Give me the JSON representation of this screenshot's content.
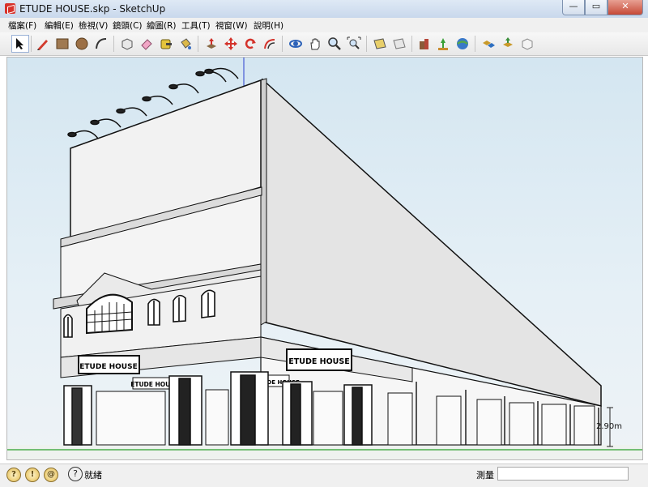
{
  "window": {
    "title": "ETUDE HOUSE.skp - SketchUp",
    "buttons": {
      "minimize": "—",
      "maximize": "▭",
      "close": "✕"
    }
  },
  "menu": [
    "檔案(F)",
    "編輯(E)",
    "檢視(V)",
    "鏡頭(C)",
    "繪圖(R)",
    "工具(T)",
    "視窗(W)",
    "說明(H)"
  ],
  "toolbar": {
    "tools": [
      "select-icon",
      "pencil-icon",
      "rectangle-icon",
      "circle-icon",
      "arc-icon",
      "make-component-icon",
      "eraser-icon",
      "tape-measure-icon",
      "paint-bucket-icon",
      "push-pull-icon",
      "move-icon",
      "rotate-icon",
      "offset-icon",
      "orbit-icon",
      "pan-icon",
      "zoom-icon",
      "zoom-extents-icon",
      "add-location-icon",
      "toggle-terrain-icon",
      "photo-textures-icon",
      "preview-in-google-earth-icon",
      "get-models-icon",
      "share-model-icon",
      "share-component-icon",
      "components-icon"
    ],
    "active_tool": "select-icon"
  },
  "viewport": {
    "signs": [
      "ETUDE HOUSE",
      "ETUDE HOUSE",
      "ETUDE HOUSE",
      "ETUDE HOUSE"
    ],
    "dimension_label": "2.90m"
  },
  "status": {
    "icons": [
      "geo-location-icon",
      "credits-icon",
      "sign-in-icon"
    ],
    "text": "就緒",
    "measure_label": "測量",
    "measure_value": ""
  }
}
